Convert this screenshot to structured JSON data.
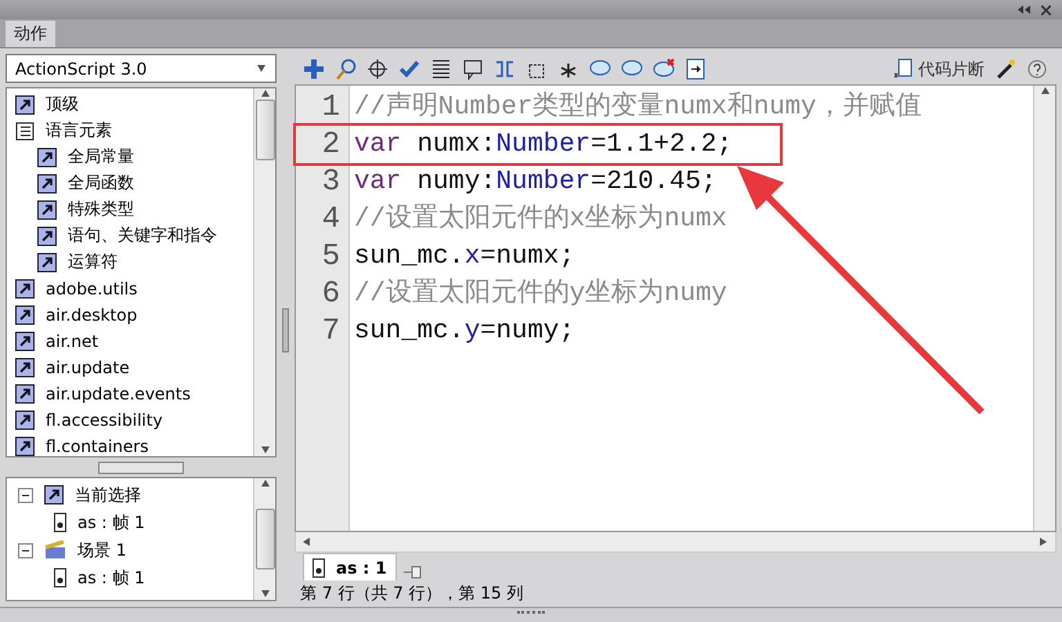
{
  "panel_tab": {
    "label": "动作",
    "selected": true
  },
  "language_select": {
    "value": "ActionScript 3.0"
  },
  "library": [
    {
      "label": "顶级",
      "kind": "package"
    },
    {
      "label": "语言元素",
      "kind": "book",
      "children": [
        {
          "label": "全局常量",
          "kind": "package"
        },
        {
          "label": "全局函数",
          "kind": "package"
        },
        {
          "label": "特殊类型",
          "kind": "package"
        },
        {
          "label": "语句、关键字和指令",
          "kind": "package"
        },
        {
          "label": "运算符",
          "kind": "package"
        }
      ]
    },
    {
      "label": "adobe.utils",
      "kind": "package"
    },
    {
      "label": "air.desktop",
      "kind": "package"
    },
    {
      "label": "air.net",
      "kind": "package"
    },
    {
      "label": "air.update",
      "kind": "package"
    },
    {
      "label": "air.update.events",
      "kind": "package"
    },
    {
      "label": "fl.accessibility",
      "kind": "package"
    },
    {
      "label": "fl.containers",
      "kind": "package"
    }
  ],
  "script_tree": [
    {
      "label": "当前选择",
      "kind": "selection",
      "expanded": true,
      "children": [
        {
          "label": "as : 帧 1",
          "kind": "frame"
        }
      ]
    },
    {
      "label": "场景 1",
      "kind": "scene",
      "expanded": true,
      "children": [
        {
          "label": "as : 帧 1",
          "kind": "frame"
        }
      ]
    }
  ],
  "snippets_button": {
    "label": "代码片断"
  },
  "code": [
    {
      "number": "1",
      "highlighted": false,
      "tokens": [
        {
          "kind": "comment",
          "text": "//声明Number类型的变量numx和numy，并赋值"
        }
      ]
    },
    {
      "number": "2",
      "highlighted": true,
      "tokens": [
        {
          "kind": "keyword",
          "text": "var"
        },
        {
          "kind": "plain",
          "text": " numx:"
        },
        {
          "kind": "type",
          "text": "Number"
        },
        {
          "kind": "plain",
          "text": "=1.1+2.2;"
        }
      ]
    },
    {
      "number": "3",
      "highlighted": false,
      "tokens": [
        {
          "kind": "keyword",
          "text": "var"
        },
        {
          "kind": "plain",
          "text": " numy:"
        },
        {
          "kind": "type",
          "text": "Number"
        },
        {
          "kind": "plain",
          "text": "=210.45;"
        }
      ]
    },
    {
      "number": "4",
      "highlighted": false,
      "tokens": [
        {
          "kind": "comment",
          "text": "//设置太阳元件的x坐标为numx"
        }
      ]
    },
    {
      "number": "5",
      "highlighted": false,
      "tokens": [
        {
          "kind": "plain",
          "text": "sun_mc."
        },
        {
          "kind": "type",
          "text": "x"
        },
        {
          "kind": "plain",
          "text": "=numx;"
        }
      ]
    },
    {
      "number": "6",
      "highlighted": false,
      "tokens": [
        {
          "kind": "comment",
          "text": "//设置太阳元件的y坐标为numy"
        }
      ]
    },
    {
      "number": "7",
      "highlighted": false,
      "tokens": [
        {
          "kind": "plain",
          "text": "sun_mc."
        },
        {
          "kind": "type",
          "text": "y"
        },
        {
          "kind": "plain",
          "text": "=numy;"
        }
      ]
    }
  ],
  "script_tab": {
    "label": "as : 1",
    "selected": true
  },
  "status_bar": "第 7 行（共 7 行），第 15 列"
}
